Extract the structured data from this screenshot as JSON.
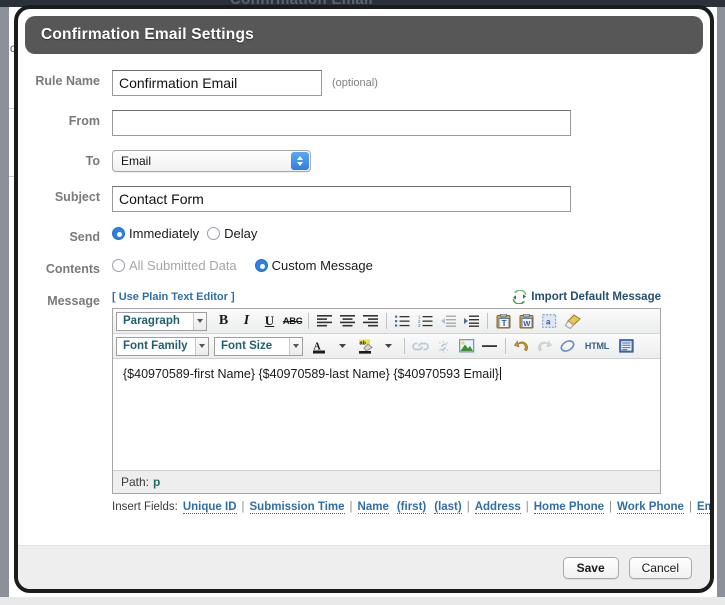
{
  "background": {
    "ghost_text": "Confirmation Email",
    "side_char": "C"
  },
  "dialog": {
    "title": "Confirmation Email Settings"
  },
  "form": {
    "rule_name": {
      "label": "Rule Name",
      "value": "Confirmation Email",
      "hint": "(optional)"
    },
    "from": {
      "label": "From",
      "value": "",
      "placeholder": ""
    },
    "to": {
      "label": "To",
      "value": "Email"
    },
    "subject": {
      "label": "Subject",
      "value": "Contact Form"
    },
    "send": {
      "label": "Send",
      "options": [
        {
          "label": "Immediately",
          "selected": true,
          "disabled": false
        },
        {
          "label": "Delay",
          "selected": false,
          "disabled": false
        }
      ]
    },
    "contents": {
      "label": "Contents",
      "options": [
        {
          "label": "All Submitted Data",
          "selected": false,
          "disabled": true
        },
        {
          "label": "Custom Message",
          "selected": true,
          "disabled": false
        }
      ]
    },
    "message": {
      "label": "Message",
      "plain_text_link": "[ Use Plain Text Editor ]",
      "import_label": "Import Default Message",
      "import_icon": "sync-icon"
    }
  },
  "editor": {
    "toolbar_row1": {
      "paragraph_style": "Paragraph",
      "buttons": [
        {
          "name": "bold-button",
          "glyph": "B"
        },
        {
          "name": "italic-button",
          "glyph": "I"
        },
        {
          "name": "underline-button",
          "glyph": "U"
        },
        {
          "name": "strikethrough-button",
          "glyph": "ABC"
        },
        {
          "name": "align-left-button",
          "glyph": ""
        },
        {
          "name": "align-center-button",
          "glyph": ""
        },
        {
          "name": "align-right-button",
          "glyph": ""
        },
        {
          "name": "bullet-list-button",
          "glyph": ""
        },
        {
          "name": "numbered-list-button",
          "glyph": ""
        },
        {
          "name": "outdent-button",
          "glyph": ""
        },
        {
          "name": "indent-button",
          "glyph": ""
        },
        {
          "name": "paste-as-text-button",
          "glyph": "T"
        },
        {
          "name": "paste-from-word-button",
          "glyph": "W"
        },
        {
          "name": "select-all-button",
          "glyph": "a"
        },
        {
          "name": "clear-formatting-button",
          "glyph": ""
        }
      ]
    },
    "toolbar_row2": {
      "font_family": "Font Family",
      "font_size": "Font Size",
      "buttons": [
        {
          "name": "text-color-button",
          "glyph": "A"
        },
        {
          "name": "highlight-color-button",
          "glyph": "ab"
        },
        {
          "name": "insert-link-button",
          "glyph": ""
        },
        {
          "name": "unlink-button",
          "glyph": ""
        },
        {
          "name": "insert-image-button",
          "glyph": ""
        },
        {
          "name": "horizontal-rule-button",
          "glyph": ""
        },
        {
          "name": "undo-button",
          "glyph": ""
        },
        {
          "name": "redo-button",
          "glyph": ""
        },
        {
          "name": "eraser-button",
          "glyph": ""
        },
        {
          "name": "html-source-button",
          "glyph": "HTML"
        },
        {
          "name": "template-button",
          "glyph": ""
        }
      ]
    },
    "content": "{$40970589-first Name} {$40970589-last Name} {$40970593 Email}",
    "path_label": "Path:",
    "path_value": "p"
  },
  "insert_fields": {
    "label": "Insert Fields:",
    "items": [
      "Unique ID",
      "Submission Time",
      "Name",
      "(first)",
      "(last)",
      "Address",
      "Home Phone",
      "Work Phone",
      "Email"
    ]
  },
  "footer": {
    "save_label": "Save",
    "cancel_label": "Cancel"
  },
  "colors": {
    "titlebar": "#575757",
    "accent_blue": "#2f7fe0",
    "link_blue": "#2f6fa8",
    "teal": "#1f5f6e",
    "footer_bg": "#eeeeee"
  }
}
